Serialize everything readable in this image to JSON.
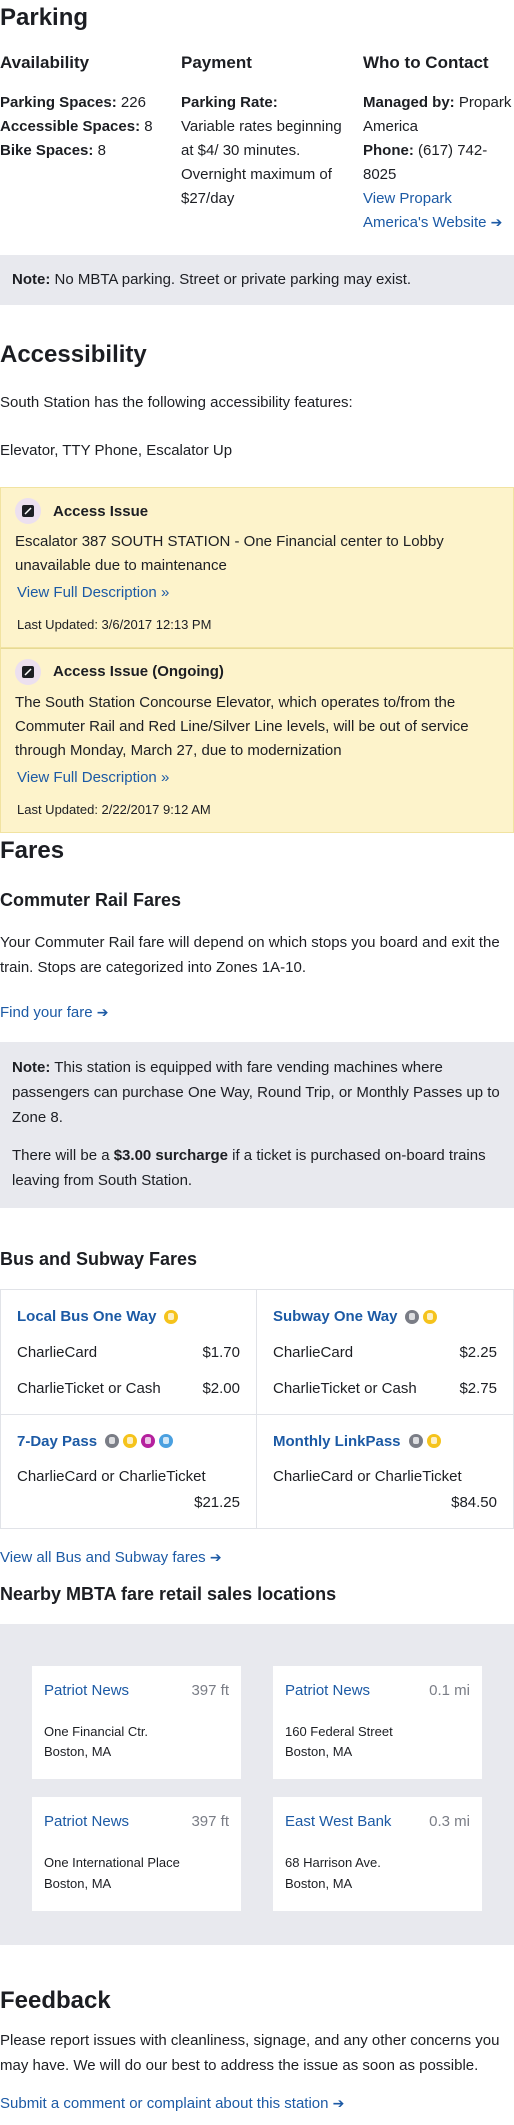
{
  "parking": {
    "title": "Parking",
    "availability": {
      "heading": "Availability",
      "lines": [
        {
          "label": "Parking Spaces:",
          "value": "226"
        },
        {
          "label": "Accessible Spaces:",
          "value": "8"
        },
        {
          "label": "Bike Spaces:",
          "value": "8"
        }
      ]
    },
    "payment": {
      "heading": "Payment",
      "label": "Parking Rate:",
      "text": "Variable rates beginning at $4/ 30 minutes. Overnight maximum of $27/day"
    },
    "contact": {
      "heading": "Who to Contact",
      "managed_label": "Managed by:",
      "managed_value": "Propark America",
      "phone_label": "Phone:",
      "phone_value": "(617) 742-8025",
      "link_text": "View Propark America's Website"
    },
    "note_label": "Note:",
    "note_text": "No MBTA parking. Street or private parking may exist."
  },
  "accessibility": {
    "title": "Accessibility",
    "intro": "South Station has the following accessibility features:",
    "features": "Elevator, TTY Phone, Escalator Up",
    "alerts": [
      {
        "title": "Access Issue",
        "body": "Escalator 387 SOUTH STATION - One Financial center to Lobby unavailable due to maintenance",
        "link": "View Full Description »",
        "updated": "Last Updated: 3/6/2017 12:13 PM"
      },
      {
        "title": "Access Issue (Ongoing)",
        "body": "The South Station Concourse Elevator, which operates to/from the Commuter Rail and Red Line/Silver Line levels, will be out of service through Monday, March 27, due to modernization",
        "link": "View Full Description »",
        "updated": "Last Updated: 2/22/2017 9:12 AM"
      }
    ]
  },
  "fares": {
    "title": "Fares",
    "commuter_title": "Commuter Rail Fares",
    "commuter_text": "Your Commuter Rail fare will depend on which stops you board and exit the train. Stops are categorized into Zones 1A-10.",
    "find_fare": "Find your fare",
    "note_label": "Note:",
    "note_text": "This station is equipped with fare vending machines where passengers can purchase One Way, Round Trip, or Monthly Passes up to Zone 8.",
    "surcharge_pre": "There will be a",
    "surcharge_bold": "$3.00 surcharge",
    "surcharge_post": "if a ticket is purchased on-board trains leaving from South Station.",
    "bus_title": "Bus and Subway Fares",
    "cards": [
      {
        "title": "Local Bus One Way",
        "icons": [
          "bus-icon"
        ],
        "rows": [
          {
            "label": "CharlieCard",
            "price": "$1.70"
          },
          {
            "label": "CharlieTicket or Cash",
            "price": "$2.00"
          }
        ]
      },
      {
        "title": "Subway One Way",
        "icons": [
          "subway-icon",
          "bus-icon"
        ],
        "rows": [
          {
            "label": "CharlieCard",
            "price": "$2.25"
          },
          {
            "label": "CharlieTicket or Cash",
            "price": "$2.75"
          }
        ]
      },
      {
        "title": "7-Day Pass",
        "icons": [
          "subway-icon",
          "bus-icon",
          "commuter-rail-icon",
          "ferry-icon"
        ],
        "stack_label": "CharlieCard or CharlieTicket",
        "stack_price": "$21.25"
      },
      {
        "title": "Monthly LinkPass",
        "icons": [
          "subway-icon",
          "bus-icon"
        ],
        "stack_label": "CharlieCard or CharlieTicket",
        "stack_price": "$84.50"
      }
    ],
    "view_all": "View all Bus and Subway fares"
  },
  "retail": {
    "title": "Nearby MBTA fare retail sales locations",
    "locations": [
      {
        "name": "Patriot News",
        "distance": "397 ft",
        "street": "One Financial Ctr.",
        "city": "Boston, MA"
      },
      {
        "name": "Patriot News",
        "distance": "0.1 mi",
        "street": "160 Federal Street",
        "city": "Boston, MA"
      },
      {
        "name": "Patriot News",
        "distance": "397 ft",
        "street": "One International Place",
        "city": "Boston, MA"
      },
      {
        "name": "East West Bank",
        "distance": "0.3 mi",
        "street": "68 Harrison Ave.",
        "city": "Boston, MA"
      }
    ]
  },
  "feedback": {
    "title": "Feedback",
    "text": "Please report issues with cleanliness, signage, and any other concerns you may have. We will do our best to address the issue as soon as possible.",
    "link": "Submit a comment or complaint about this station"
  },
  "colors": {
    "link": "#1c5aa5",
    "note_bg": "#e8e9ee",
    "alert_bg": "#fdf3cb",
    "bus": "#f5c31c",
    "subway": "#7a7d86",
    "commuter_rail": "#b5219e",
    "ferry": "#4aa0e0"
  }
}
